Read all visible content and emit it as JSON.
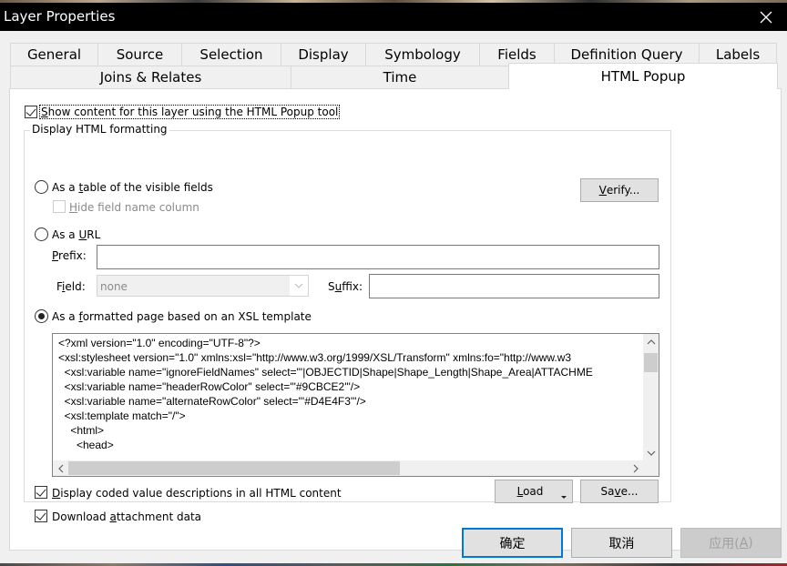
{
  "window": {
    "title": "Layer Properties",
    "close_icon": "close-icon"
  },
  "tabs": {
    "row1": [
      {
        "label": "General"
      },
      {
        "label": "Source"
      },
      {
        "label": "Selection"
      },
      {
        "label": "Display"
      },
      {
        "label": "Symbology"
      },
      {
        "label": "Fields"
      },
      {
        "label": "Definition Query"
      },
      {
        "label": "Labels"
      }
    ],
    "row2": [
      {
        "label": "Joins & Relates"
      },
      {
        "label": "Time"
      },
      {
        "label": "HTML Popup",
        "active": true
      }
    ]
  },
  "html_popup": {
    "show_content": {
      "label": "Show content for this layer using the HTML Popup tool",
      "checked": true
    },
    "group_title": "Display HTML formatting",
    "format_options": [
      {
        "label_pre": "As a ",
        "label_u": "t",
        "label_post": "able of the visible fields",
        "selected": false
      },
      {
        "label_pre": "As a ",
        "label_u": "U",
        "label_post": "RL",
        "selected": false
      },
      {
        "label_pre": "As a ",
        "label_u": "f",
        "label_post": "ormatted page based on an XSL template",
        "selected": true
      }
    ],
    "hide_field_name": {
      "label_u": "H",
      "label_post": "ide field name column",
      "checked": false,
      "enabled": false
    },
    "verify_button": {
      "label_u": "V",
      "label_post": "erify..."
    },
    "prefix": {
      "label_u": "P",
      "label_post": "refix:",
      "value": ""
    },
    "field": {
      "label_pre": "F",
      "label_u": "i",
      "label_post": "eld:",
      "value": "none"
    },
    "suffix": {
      "label_pre": "S",
      "label_u": "u",
      "label_post": "ffix:",
      "value": ""
    },
    "xsl_lines": [
      "<?xml version=\"1.0\" encoding=\"UTF-8\"?>",
      "<xsl:stylesheet version=\"1.0\" xmlns:xsl=\"http://www.w3.org/1999/XSL/Transform\" xmlns:fo=\"http://www.w3",
      "  <xsl:variable name=\"ignoreFieldNames\" select=\"'|OBJECTID|Shape|Shape_Length|Shape_Area|ATTACHME",
      "  <xsl:variable name=\"headerRowColor\" select=\"'#9CBCE2'\"/>",
      "  <xsl:variable name=\"alternateRowColor\" select=\"'#D4E4F3'\"/>",
      "  <xsl:template match=\"/\">",
      "    <html>",
      "      <head>"
    ],
    "load_button": {
      "label_u": "L",
      "label_post": "oad"
    },
    "save_button": {
      "label_pre": "Sa",
      "label_u": "v",
      "label_post": "e..."
    },
    "coded_values": {
      "label_u": "D",
      "label_post": "isplay coded value descriptions in all HTML content",
      "checked": true
    },
    "download_attachments": {
      "label_pre": "Download ",
      "label_u": "a",
      "label_post": "ttachment data",
      "checked": true
    }
  },
  "footer": {
    "ok": "确定",
    "cancel": "取消",
    "apply_pre": "应用(",
    "apply_u": "A",
    "apply_post": ")"
  }
}
